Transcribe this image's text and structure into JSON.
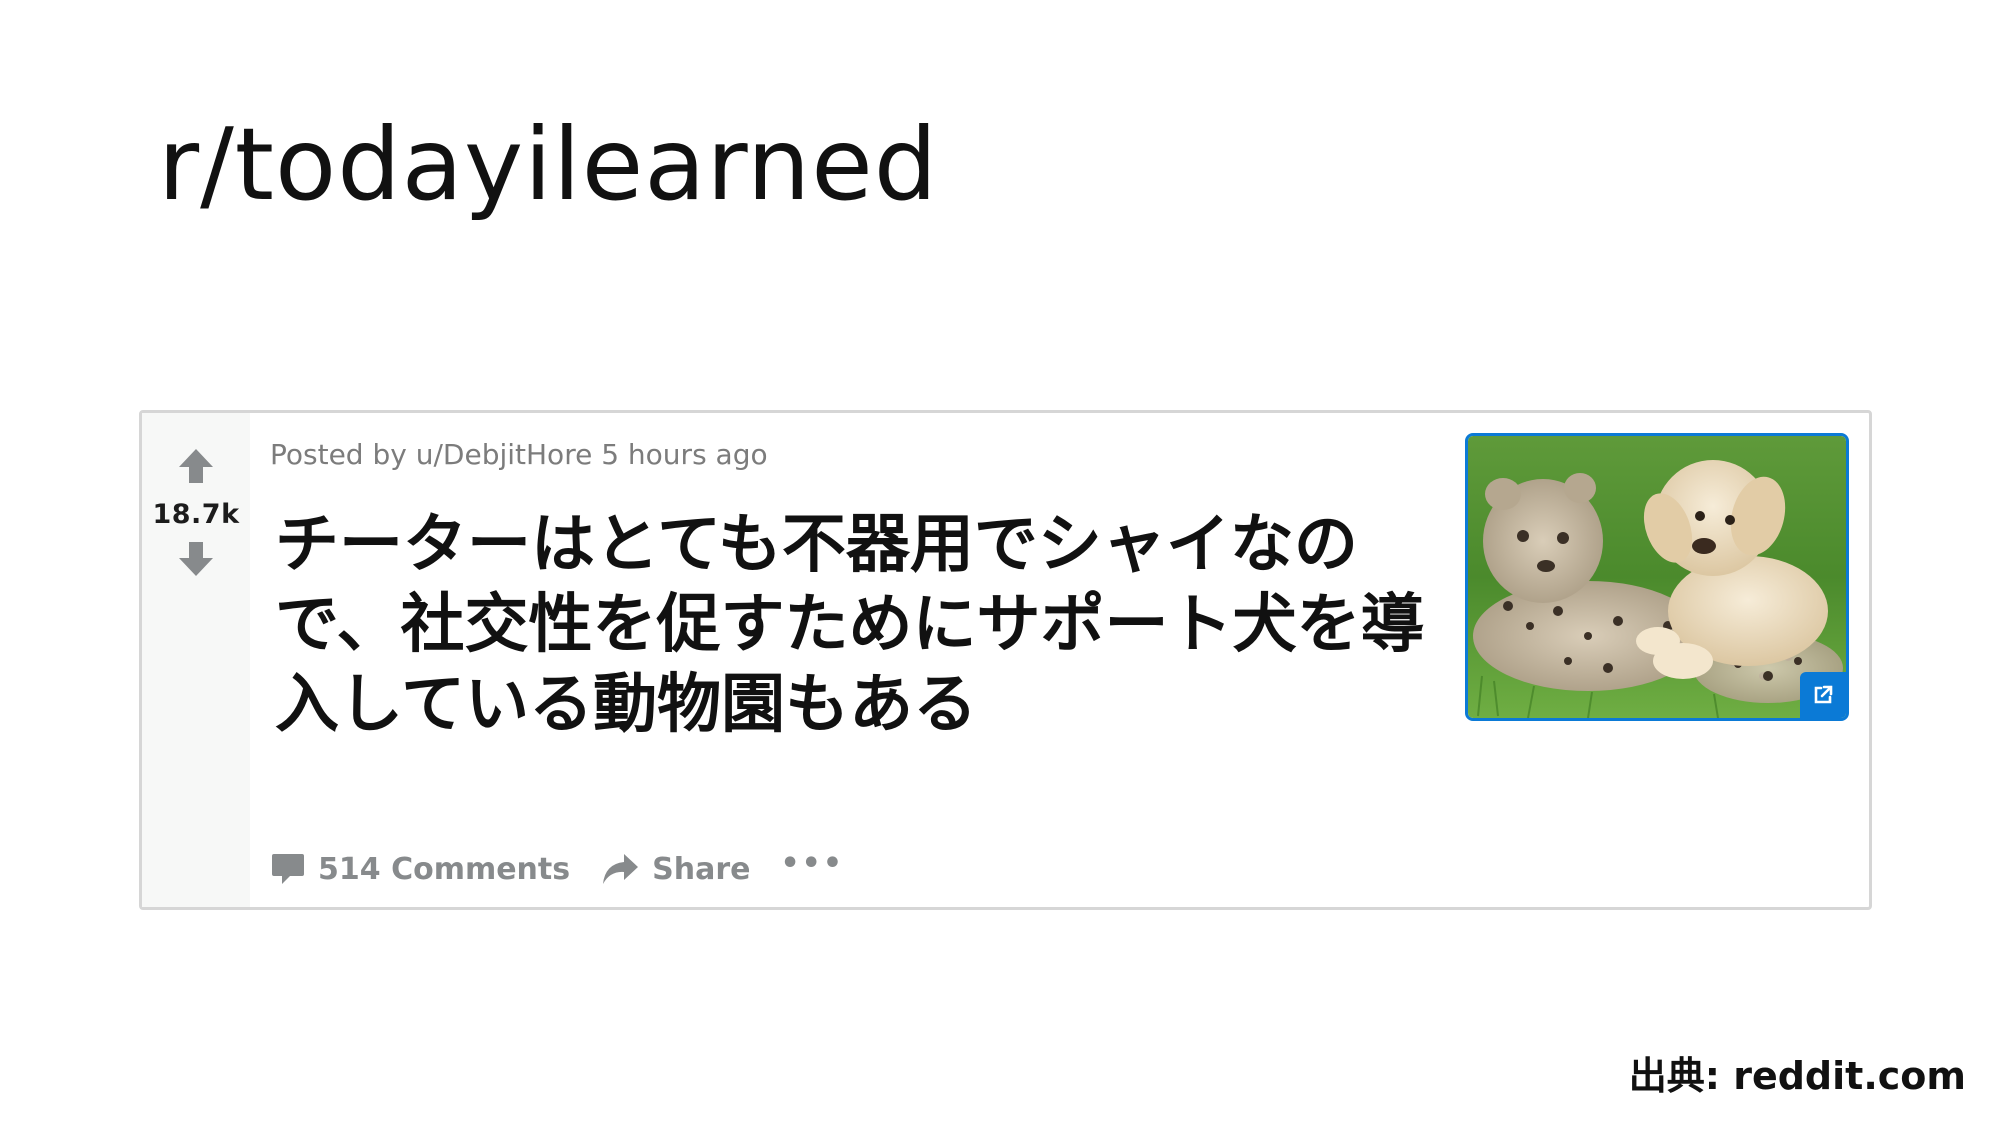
{
  "slide": {
    "title": "r/todayilearned",
    "source": "出典: reddit.com"
  },
  "post": {
    "score": "18.7k",
    "meta": "Posted by u/DebjitHore 5 hours ago",
    "title": "チーターはとても不器用でシャイなので、社交性を促すためにサポート犬を導入している動物園もある",
    "thumbnail_alt": "cheetah-cub-and-puppy-thumbnail",
    "actions": {
      "comments": "514 Comments",
      "share": "Share",
      "more": "•••"
    }
  },
  "colors": {
    "accent": "#0b7ad6",
    "muted": "#878a8c",
    "vote_rail": "#f7f8f7"
  },
  "icons": {
    "upvote": "arrow-up-icon",
    "downvote": "arrow-down-icon",
    "comments": "comment-bubble-icon",
    "share": "share-arrow-icon",
    "external": "external-link-icon"
  }
}
